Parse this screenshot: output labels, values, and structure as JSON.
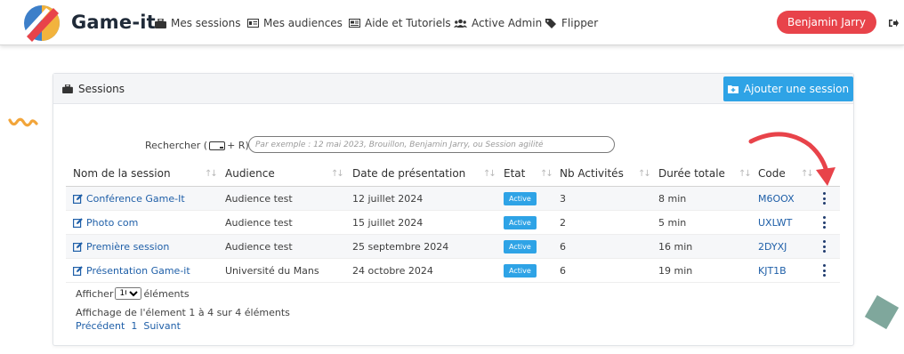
{
  "app": {
    "brand": "Game-it"
  },
  "nav": {
    "items": [
      {
        "label": "Mes sessions",
        "icon": "briefcase-icon"
      },
      {
        "label": "Mes audiences",
        "icon": "id-card-icon"
      },
      {
        "label": "Aide et Tutoriels",
        "icon": "newspaper-icon"
      },
      {
        "label": "Active Admin",
        "icon": "users-icon"
      },
      {
        "label": "Flipper",
        "icon": "tags-icon"
      }
    ],
    "user": "Benjamin Jarry"
  },
  "card": {
    "title": "Sessions",
    "add_button": "Ajouter une session",
    "search_label_prefix": "Rechercher (",
    "search_label_suffix": " + R) :",
    "search_placeholder": "Par exemple : 12 mai 2023, Brouillon, Benjamin Jarry, ou Session agilité"
  },
  "table": {
    "headers": [
      "Nom de la session",
      "Audience",
      "Date de présentation",
      "Etat",
      "Nb Activités",
      "Durée totale",
      "Code"
    ],
    "rows": [
      {
        "name": "Conférence Game-It",
        "audience": "Audience test",
        "date": "12 juillet 2024",
        "status": "Active",
        "activities": "3",
        "duration": "8 min",
        "code": "M6OOX"
      },
      {
        "name": "Photo com",
        "audience": "Audience test",
        "date": "15 juillet 2024",
        "status": "Active",
        "activities": "2",
        "duration": "5 min",
        "code": "UXLWT"
      },
      {
        "name": "Première session",
        "audience": "Audience test",
        "date": "25 septembre 2024",
        "status": "Active",
        "activities": "6",
        "duration": "16 min",
        "code": "2DYXJ"
      },
      {
        "name": "Présentation Game-it",
        "audience": "Université du Mans",
        "date": "24 octobre 2024",
        "status": "Active",
        "activities": "6",
        "duration": "19 min",
        "code": "KJT1B"
      }
    ]
  },
  "footer": {
    "show_prefix": "Afficher",
    "show_value": "10",
    "show_suffix": "éléments",
    "info": "Affichage de l'élement 1 à 4 sur 4 éléments",
    "prev": "Précédent",
    "page": "1",
    "next": "Suivant"
  },
  "colors": {
    "accent": "#2ea3e6",
    "user_button": "#e8434a",
    "link": "#1f5fa8",
    "annotation_arrow": "#e8434a"
  }
}
